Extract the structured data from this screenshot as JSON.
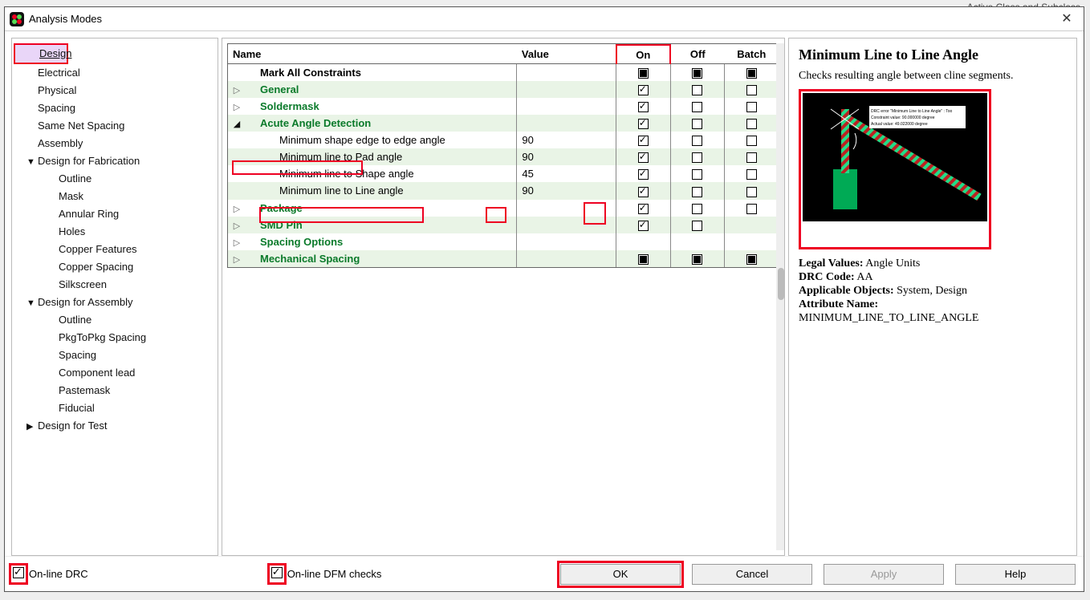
{
  "bg_label": "Active Class and Subclass",
  "window": {
    "title": "Analysis Modes"
  },
  "nav": {
    "items": [
      {
        "label": "Design",
        "level": 0,
        "hl": true
      },
      {
        "label": "Electrical",
        "level": 0
      },
      {
        "label": "Physical",
        "level": 0
      },
      {
        "label": "Spacing",
        "level": 0
      },
      {
        "label": "Same Net Spacing",
        "level": 0
      },
      {
        "label": "Assembly",
        "level": 0
      },
      {
        "label": "Design for Fabrication",
        "level": 0,
        "tog": "▼"
      },
      {
        "label": "Outline",
        "level": 1
      },
      {
        "label": "Mask",
        "level": 1
      },
      {
        "label": "Annular Ring",
        "level": 1
      },
      {
        "label": "Holes",
        "level": 1
      },
      {
        "label": "Copper Features",
        "level": 1
      },
      {
        "label": "Copper Spacing",
        "level": 1
      },
      {
        "label": "Silkscreen",
        "level": 1
      },
      {
        "label": "Design for Assembly",
        "level": 0,
        "tog": "▼"
      },
      {
        "label": "Outline",
        "level": 1
      },
      {
        "label": "PkgToPkg Spacing",
        "level": 1
      },
      {
        "label": "Spacing",
        "level": 1
      },
      {
        "label": "Component lead",
        "level": 1
      },
      {
        "label": "Pastemask",
        "level": 1
      },
      {
        "label": "Fiducial",
        "level": 1
      },
      {
        "label": "Design for Test",
        "level": 0,
        "tog": "▶"
      }
    ]
  },
  "grid": {
    "headers": {
      "name": "Name",
      "value": "Value",
      "on": "On",
      "off": "Off",
      "batch": "Batch"
    },
    "rows": [
      {
        "indent": 1,
        "tog": "",
        "name": "Mark All Constraints",
        "cls": "bold",
        "shade": false,
        "on": "f",
        "off": "f",
        "batch": "f",
        "value": ""
      },
      {
        "indent": 1,
        "tog": "▷",
        "name": "General",
        "cls": "green",
        "shade": true,
        "on": "c",
        "off": "e",
        "batch": "e",
        "value": ""
      },
      {
        "indent": 1,
        "tog": "▷",
        "name": "Soldermask",
        "cls": "green",
        "shade": false,
        "on": "c",
        "off": "e",
        "batch": "e",
        "value": ""
      },
      {
        "indent": 1,
        "tog": "◢",
        "name": "Acute Angle Detection",
        "cls": "green",
        "shade": true,
        "on": "c",
        "off": "e",
        "batch": "e",
        "value": "",
        "hl": true
      },
      {
        "indent": 2,
        "tog": "",
        "name": "Minimum shape edge to edge angle",
        "shade": false,
        "on": "c",
        "off": "e",
        "batch": "e",
        "value": "90"
      },
      {
        "indent": 2,
        "tog": "",
        "name": "Minimum line to Pad angle",
        "shade": true,
        "on": "c",
        "off": "e",
        "batch": "e",
        "value": "90"
      },
      {
        "indent": 2,
        "tog": "",
        "name": "Minimum line to Shape angle",
        "shade": false,
        "on": "c",
        "off": "e",
        "batch": "e",
        "value": "45",
        "row_hl": true
      },
      {
        "indent": 2,
        "tog": "",
        "name": "Minimum line to Line angle",
        "shade": true,
        "on": "c",
        "off": "e",
        "batch": "e",
        "value": "90"
      },
      {
        "indent": 1,
        "tog": "▷",
        "name": "Package",
        "cls": "green",
        "shade": false,
        "on": "c",
        "off": "e",
        "batch": "e",
        "value": ""
      },
      {
        "indent": 1,
        "tog": "▷",
        "name": "SMD Pin",
        "cls": "green",
        "shade": true,
        "on": "c",
        "off": "e",
        "batch": "",
        "value": ""
      },
      {
        "indent": 1,
        "tog": "▷",
        "name": "Spacing Options",
        "cls": "green",
        "shade": false,
        "on": "",
        "off": "",
        "batch": "",
        "value": ""
      },
      {
        "indent": 1,
        "tog": "▷",
        "name": "Mechanical Spacing",
        "cls": "green",
        "shade": true,
        "on": "f",
        "off": "f",
        "batch": "f",
        "value": ""
      }
    ]
  },
  "info": {
    "title": "Minimum Line to Line Angle",
    "desc": "Checks resulting angle between cline segments.",
    "callout_l1": "DRC error \"Minimum Line to Line Angle\" : Too",
    "callout_l2": "Constraint value: 90.000000 degree",
    "callout_l3": "Actual value: 49.022000 degree",
    "legal_values_k": "Legal Values:",
    "legal_values_v": " Angle Units",
    "drc_code_k": "DRC Code:",
    "drc_code_v": " AA",
    "applicable_k": "Applicable Objects:",
    "applicable_v": " System, Design",
    "attr_name_k": "Attribute Name:",
    "attr_name_v": "MINIMUM_LINE_TO_LINE_ANGLE"
  },
  "footer": {
    "online_drc": "On-line DRC",
    "online_dfm": "On-line DFM checks",
    "ok": "OK",
    "cancel": "Cancel",
    "apply": "Apply",
    "help": "Help"
  }
}
